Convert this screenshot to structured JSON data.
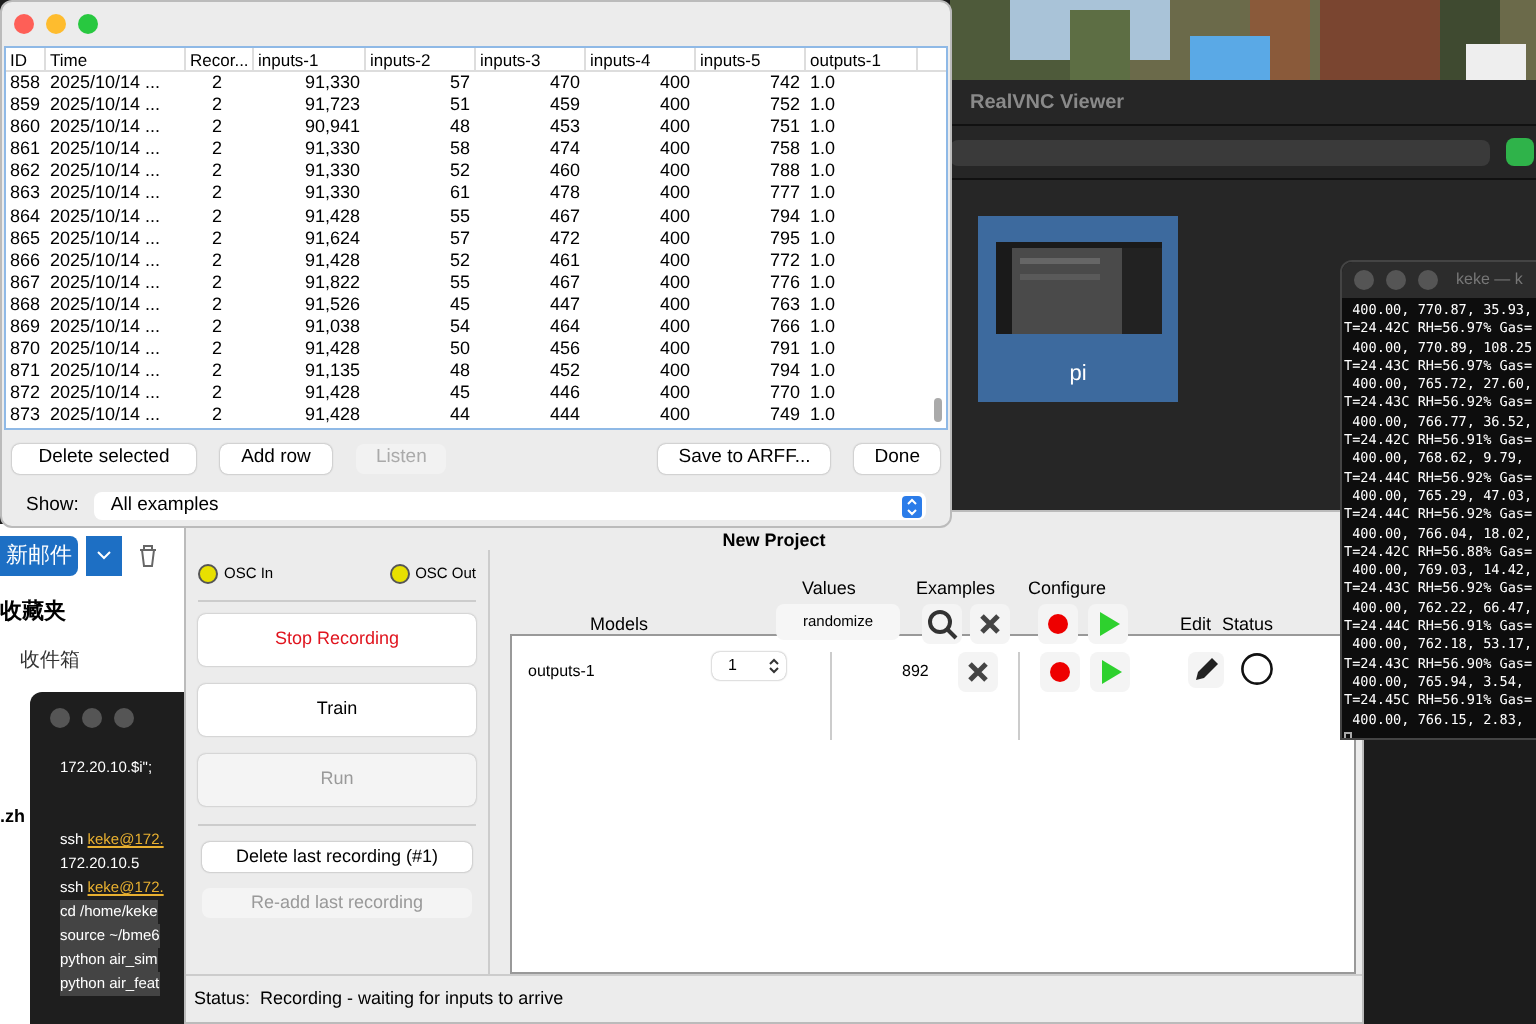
{
  "vnc_window": {
    "title": "RealVNC Viewer",
    "computers": [
      {
        "name": "pi",
        "selected": true
      }
    ]
  },
  "terminal_right": {
    "title": "keke — k",
    "lines": [
      "400.00, 770.87, 35.93,",
      "T=24.42C RH=56.97% Gas=",
      "400.00, 770.89, 108.25",
      "T=24.43C RH=56.97% Gas=",
      "400.00, 765.72, 27.60,",
      "T=24.43C RH=56.92% Gas=",
      "400.00, 766.77, 36.52,",
      "T=24.42C RH=56.91% Gas=",
      "400.00, 768.62, 9.79,",
      "T=24.44C RH=56.92% Gas=",
      "400.00, 765.29, 47.03,",
      "T=24.44C RH=56.92% Gas=",
      "400.00, 766.04, 18.02,",
      "T=24.42C RH=56.88% Gas=",
      "400.00, 769.03, 14.42,",
      "T=24.43C RH=56.92% Gas=",
      "400.00, 762.22, 66.47,",
      "T=24.44C RH=56.91% Gas=",
      "400.00, 762.18, 53.17,",
      "T=24.43C RH=56.90% Gas=",
      "400.00, 765.94, 3.54,",
      "T=24.45C RH=56.91% Gas=",
      "400.00, 766.15, 2.83,"
    ]
  },
  "mail_window": {
    "new_button": "新邮件",
    "folders": [
      "收藏夹",
      "收件箱",
      ".zh"
    ]
  },
  "terminal_left": {
    "lines": [
      {
        "text": "172.20.10.$i\";",
        "selected": false
      },
      {
        "text": "ssh ",
        "link": "keke@172.",
        "selected": false
      },
      {
        "text": "172.20.10.5",
        "selected": false
      },
      {
        "text": "ssh ",
        "link": "keke@172.",
        "selected": false
      },
      {
        "text": "cd /home/keke",
        "selected": true
      },
      {
        "text": "source ~/bme6",
        "selected": true
      },
      {
        "text": "python air_sim",
        "selected": true
      },
      {
        "text": "python air_feat",
        "selected": true
      }
    ]
  },
  "examples_window": {
    "columns": [
      "ID",
      "Time",
      "Recor...",
      "inputs-1",
      "inputs-2",
      "inputs-3",
      "inputs-4",
      "inputs-5",
      "outputs-1"
    ],
    "rows": [
      [
        "858",
        "2025/10/14 ...",
        "2",
        "91,330",
        "57",
        "470",
        "400",
        "742",
        "1.0"
      ],
      [
        "859",
        "2025/10/14 ...",
        "2",
        "91,723",
        "51",
        "459",
        "400",
        "752",
        "1.0"
      ],
      [
        "860",
        "2025/10/14 ...",
        "2",
        "90,941",
        "48",
        "453",
        "400",
        "751",
        "1.0"
      ],
      [
        "861",
        "2025/10/14 ...",
        "2",
        "91,330",
        "58",
        "474",
        "400",
        "758",
        "1.0"
      ],
      [
        "862",
        "2025/10/14 ...",
        "2",
        "91,330",
        "52",
        "460",
        "400",
        "788",
        "1.0"
      ],
      [
        "863",
        "2025/10/14 ...",
        "2",
        "91,330",
        "61",
        "478",
        "400",
        "777",
        "1.0"
      ],
      [
        "864",
        "2025/10/14 ...",
        "2",
        "91,428",
        "55",
        "467",
        "400",
        "794",
        "1.0"
      ],
      [
        "865",
        "2025/10/14 ...",
        "2",
        "91,624",
        "57",
        "472",
        "400",
        "795",
        "1.0"
      ],
      [
        "866",
        "2025/10/14 ...",
        "2",
        "91,428",
        "52",
        "461",
        "400",
        "772",
        "1.0"
      ],
      [
        "867",
        "2025/10/14 ...",
        "2",
        "91,822",
        "55",
        "467",
        "400",
        "776",
        "1.0"
      ],
      [
        "868",
        "2025/10/14 ...",
        "2",
        "91,526",
        "45",
        "447",
        "400",
        "763",
        "1.0"
      ],
      [
        "869",
        "2025/10/14 ...",
        "2",
        "91,038",
        "54",
        "464",
        "400",
        "766",
        "1.0"
      ],
      [
        "870",
        "2025/10/14 ...",
        "2",
        "91,428",
        "50",
        "456",
        "400",
        "791",
        "1.0"
      ],
      [
        "871",
        "2025/10/14 ...",
        "2",
        "91,135",
        "48",
        "452",
        "400",
        "794",
        "1.0"
      ],
      [
        "872",
        "2025/10/14 ...",
        "2",
        "91,428",
        "45",
        "446",
        "400",
        "770",
        "1.0"
      ],
      [
        "873",
        "2025/10/14 ...",
        "2",
        "91,428",
        "44",
        "444",
        "400",
        "749",
        "1.0"
      ]
    ],
    "buttons": [
      {
        "label": "Delete selected",
        "disabled": false
      },
      {
        "label": "Add row",
        "disabled": false
      },
      {
        "label": "Listen",
        "disabled": true
      },
      {
        "label": "Save to ARFF...",
        "disabled": false
      },
      {
        "label": "Done",
        "disabled": false
      }
    ],
    "show_label": "Show:",
    "show_value": "All examples"
  },
  "project_window": {
    "title": "New Project",
    "osc": [
      {
        "label": "OSC In",
        "color": "#e8e000"
      },
      {
        "label": "OSC Out",
        "color": "#e8e000"
      }
    ],
    "actions": [
      {
        "label": "Stop Recording",
        "disabled": false,
        "alert": true
      },
      {
        "label": "Train",
        "disabled": false,
        "alert": false
      },
      {
        "label": "Run",
        "disabled": true,
        "alert": false
      }
    ],
    "recording_buttons": [
      {
        "label": "Delete last recording (#1)",
        "disabled": false
      },
      {
        "label": "Re-add last recording",
        "disabled": true
      }
    ],
    "headers": {
      "values": "Values",
      "examples": "Examples",
      "configure": "Configure",
      "models": "Models",
      "edit": "Edit",
      "status": "Status"
    },
    "randomize": "randomize",
    "models": [
      {
        "name": "outputs-1",
        "value": "1",
        "examples": "892"
      }
    ],
    "status_label": "Status:",
    "status_text": "Recording - waiting for inputs to arrive"
  }
}
